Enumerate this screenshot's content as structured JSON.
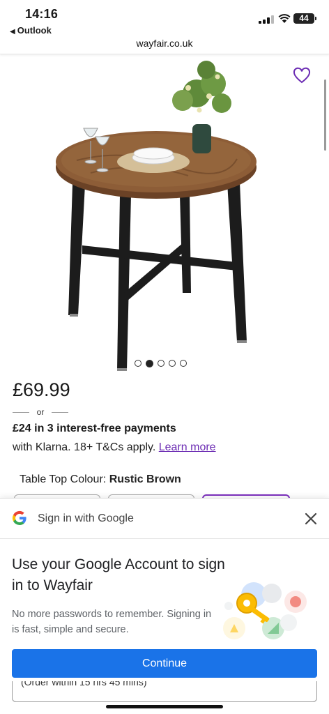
{
  "status_bar": {
    "time": "14:16",
    "back_app": "Outlook",
    "battery": "44"
  },
  "browser": {
    "url": "wayfair.co.uk"
  },
  "product": {
    "image_alt": "Round rustic brown wooden table with black metal legs",
    "gallery": {
      "total": 5,
      "active_index": 1
    },
    "price": "£69.99",
    "or_text": "or",
    "klarna_title": "£24 in 3 interest-free payments",
    "klarna_sub": "with Klarna. 18+ T&Cs apply.",
    "learn_more": "Learn more",
    "colour_label": "Table Top Colour:",
    "colour_value": "Rustic Brown"
  },
  "google_sheet": {
    "header_title": "Sign in with Google",
    "title": "Use your Google Account to sign in to Wayfair",
    "description": "No more passwords to remember. Signing in is fast, simple and secure.",
    "continue_label": "Continue",
    "peek_text": "(Order within 15 hrs 45 mins)"
  },
  "colors": {
    "accent_purple": "#6b2bb3",
    "google_blue": "#1a73e8"
  }
}
